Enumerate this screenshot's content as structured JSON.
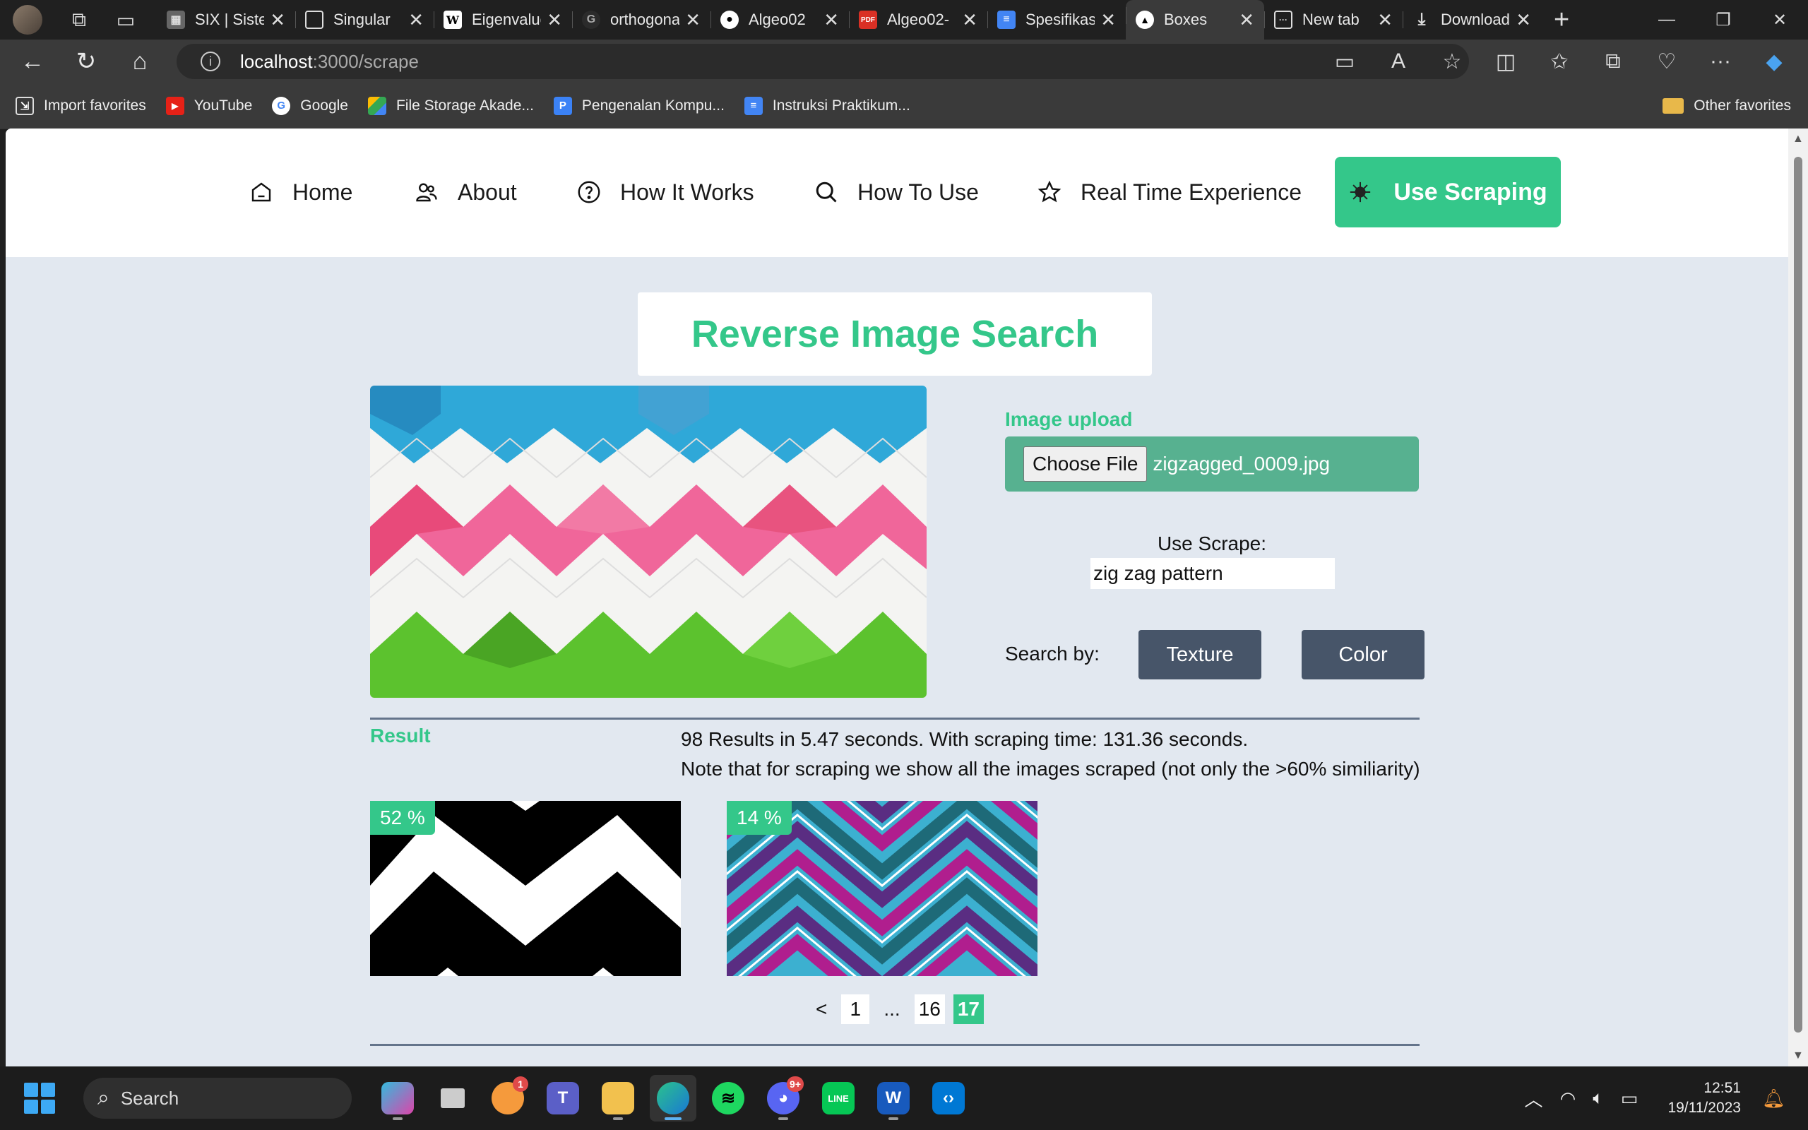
{
  "browser": {
    "tabs": [
      {
        "title": "SIX | Sistem",
        "icon": "six-icon"
      },
      {
        "title": "Singular",
        "icon": "document-icon"
      },
      {
        "title": "Eigenvalue",
        "icon": "wikipedia-icon"
      },
      {
        "title": "orthogonal",
        "icon": "google-icon"
      },
      {
        "title": "Algeo02",
        "icon": "github-icon"
      },
      {
        "title": "Algeo02-",
        "icon": "pdf-icon"
      },
      {
        "title": "Spesifikasi",
        "icon": "docs-icon"
      },
      {
        "title": "Boxes",
        "icon": "boxes-icon"
      },
      {
        "title": "New tab",
        "icon": "newtab-icon"
      },
      {
        "title": "Downloads",
        "icon": "download-icon"
      }
    ],
    "active_tab": 7,
    "url_host": "localhost",
    "url_path": ":3000/scrape",
    "bookmarks": [
      {
        "label": "Import favorites",
        "color": "#3a3a3a"
      },
      {
        "label": "YouTube",
        "color": "#e62117"
      },
      {
        "label": "Google",
        "color": "#ffffff"
      },
      {
        "label": "File Storage Akade...",
        "color": "#1ea362"
      },
      {
        "label": "Pengenalan Kompu...",
        "color": "#3b82f6"
      },
      {
        "label": "Instruksi Praktikum...",
        "color": "#4285f4"
      }
    ],
    "other_favorites": "Other favorites"
  },
  "nav": {
    "home": "Home",
    "about": "About",
    "how_it_works": "How It Works",
    "how_to_use": "How To Use",
    "real_time": "Real Time Experience",
    "use_scraping": "Use Scraping"
  },
  "main": {
    "title": "Reverse Image Search",
    "upload_label": "Image upload",
    "choose_file": "Choose File",
    "file_name": "zigzagged_0009.jpg",
    "scrape_label": "Use Scrape:",
    "scrape_value": "zig zag pattern",
    "search_by": "Search by:",
    "texture_btn": "Texture",
    "color_btn": "Color",
    "result_label": "Result",
    "stats_line1": "98 Results in 5.47 seconds. With scraping time: 131.36 seconds.",
    "stats_line2": "Note that for scraping we show all the images scraped (not only the >60% similiarity)",
    "results": [
      {
        "similarity": "52 %"
      },
      {
        "similarity": "14 %"
      }
    ],
    "pager": {
      "prev": "<",
      "first": "1",
      "ellipsis": "...",
      "pages": [
        "16",
        "17"
      ],
      "current": "17"
    }
  },
  "taskbar": {
    "search": "Search",
    "time": "12:51",
    "date": "19/11/2023",
    "discord_badge": "9+",
    "app_badge": "1"
  },
  "colors": {
    "accent": "#34c78a",
    "button": "#475569",
    "page_bg": "#e2e8f0"
  }
}
